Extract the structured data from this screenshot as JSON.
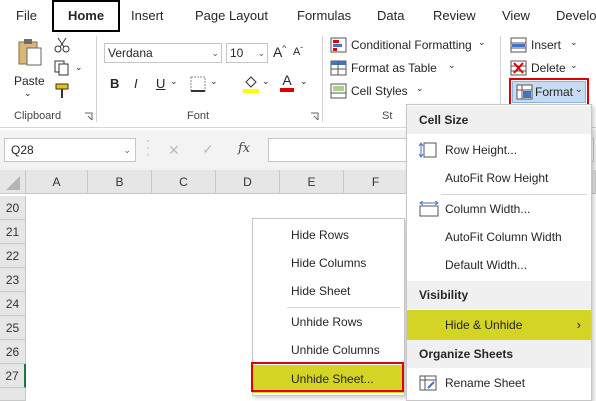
{
  "tabs": [
    "File",
    "Home",
    "Insert",
    "Page Layout",
    "Formulas",
    "Data",
    "Review",
    "View",
    "Develo"
  ],
  "active_tab": "Home",
  "clipboard": {
    "paste_label": "Paste",
    "group_label": "Clipboard"
  },
  "font": {
    "name": "Verdana",
    "size": "10",
    "grow_label": "A",
    "shrink_label": "A",
    "bold": "B",
    "italic": "I",
    "underline": "U",
    "font_color_label": "A",
    "group_label": "Font",
    "font_color": "#e00000",
    "fill_color": "#ffff00"
  },
  "styles": {
    "conditional_formatting": "Conditional Formatting",
    "format_as_table": "Format as Table",
    "cell_styles": "Cell Styles",
    "group_label_partial": "St"
  },
  "cells": {
    "insert": "Insert",
    "delete": "Delete",
    "format": "Format"
  },
  "name_box": "Q28",
  "formula_bar": {
    "fx": "fx"
  },
  "columns": [
    "A",
    "B",
    "C",
    "D",
    "E",
    "F"
  ],
  "rows": [
    "20",
    "21",
    "22",
    "23",
    "24",
    "25",
    "26",
    "27"
  ],
  "format_menu": {
    "cell_size_header": "Cell Size",
    "row_height": "Row Height...",
    "autofit_row_height": "AutoFit Row Height",
    "column_width": "Column Width...",
    "autofit_column_width": "AutoFit Column Width",
    "default_width": "Default Width...",
    "visibility_header": "Visibility",
    "hide_unhide": "Hide & Unhide",
    "organize_header": "Organize Sheets",
    "rename_sheet": "Rename Sheet"
  },
  "hide_submenu": {
    "hide_rows": "Hide Rows",
    "hide_columns": "Hide Columns",
    "hide_sheet": "Hide Sheet",
    "unhide_rows": "Unhide Rows",
    "unhide_columns": "Unhide Columns",
    "unhide_sheet": "Unhide Sheet..."
  },
  "colors": {
    "highlight": "#d4d424",
    "annotation_red": "#e00000",
    "excel_green": "#217346"
  }
}
